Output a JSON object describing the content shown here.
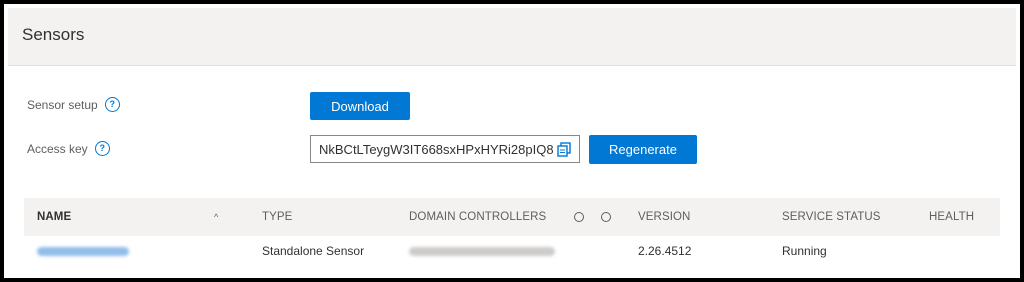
{
  "page": {
    "title": "Sensors"
  },
  "setup": {
    "sensor_setup_label": "Sensor setup",
    "access_key_label": "Access key",
    "help_glyph": "?",
    "download_label": "Download",
    "access_key_value": "NkBCtLTeygW3IT668sxHPxHYRi28pIQ8",
    "regenerate_label": "Regenerate"
  },
  "table": {
    "columns": {
      "name": "NAME",
      "type": "TYPE",
      "domain_controllers": "DOMAIN CONTROLLERS",
      "version": "VERSION",
      "service_status": "SERVICE STATUS",
      "health": "HEALTH"
    },
    "sort_glyph": "^",
    "rows": [
      {
        "type": "Standalone Sensor",
        "version": "2.26.4512",
        "service_status": "Running"
      }
    ]
  },
  "colors": {
    "accent": "#0078d4",
    "header_bg": "#f3f2f1"
  },
  "icons": [
    "help-icon",
    "copy-icon",
    "sort-ascending-icon",
    "column-options-icon"
  ]
}
